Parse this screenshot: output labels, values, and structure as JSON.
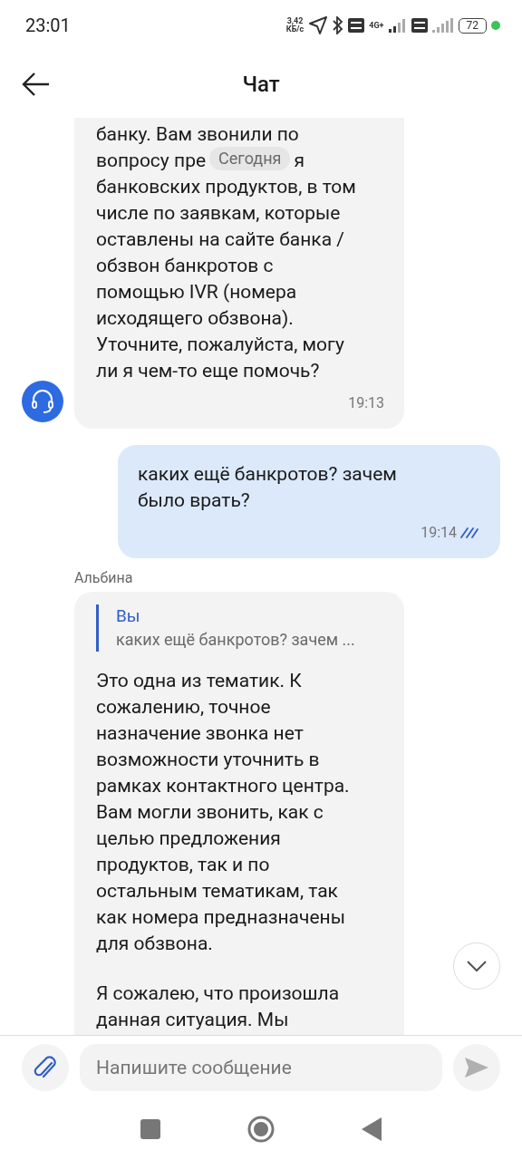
{
  "status_bar": {
    "time": "23:01",
    "speed_value": "3,42",
    "speed_unit": "КБ/с",
    "network": "4G+",
    "battery": "72"
  },
  "header": {
    "title": "Чат"
  },
  "date_chip": "Сегодня",
  "messages": [
    {
      "kind": "incoming",
      "avatar": true,
      "line_before_chip": "вопросу пре",
      "line_after_chip": "я",
      "lines_top": [
        "банку. Вам звонили по"
      ],
      "lines": [
        "банковских продуктов, в том",
        "числе по заявкам, которые",
        "оставлены на сайте банка /",
        "обзвон банкротов с",
        "помощью IVR (номера",
        "исходящего обзвона).",
        "Уточните, пожалуйста, могу",
        "ли я чем-то еще помочь?"
      ],
      "time": "19:13"
    },
    {
      "kind": "outgoing",
      "lines": [
        "каких ещё банкротов? зачем",
        "было врать?"
      ],
      "time": "19:14",
      "read": true
    },
    {
      "kind": "incoming",
      "avatar": false,
      "sender": "Альбина",
      "quote": {
        "author": "Вы",
        "text": "каких ещё банкротов? зачем ..."
      },
      "paragraphs": [
        [
          "Это одна из тематик. К",
          "сожалению, точное",
          "назначение звонка нет",
          "возможности уточнить в",
          "рамках контактного центра.",
          "Вам могли звонить, как с",
          "целью предложения",
          "продуктов, так и по",
          "остальным тематикам, так",
          "как номера предназначены",
          "для обзвона."
        ],
        [
          "Я сожалею, что произошла",
          "данная ситуация. Мы"
        ]
      ]
    }
  ],
  "composer": {
    "placeholder": "Напишите сообщение"
  }
}
